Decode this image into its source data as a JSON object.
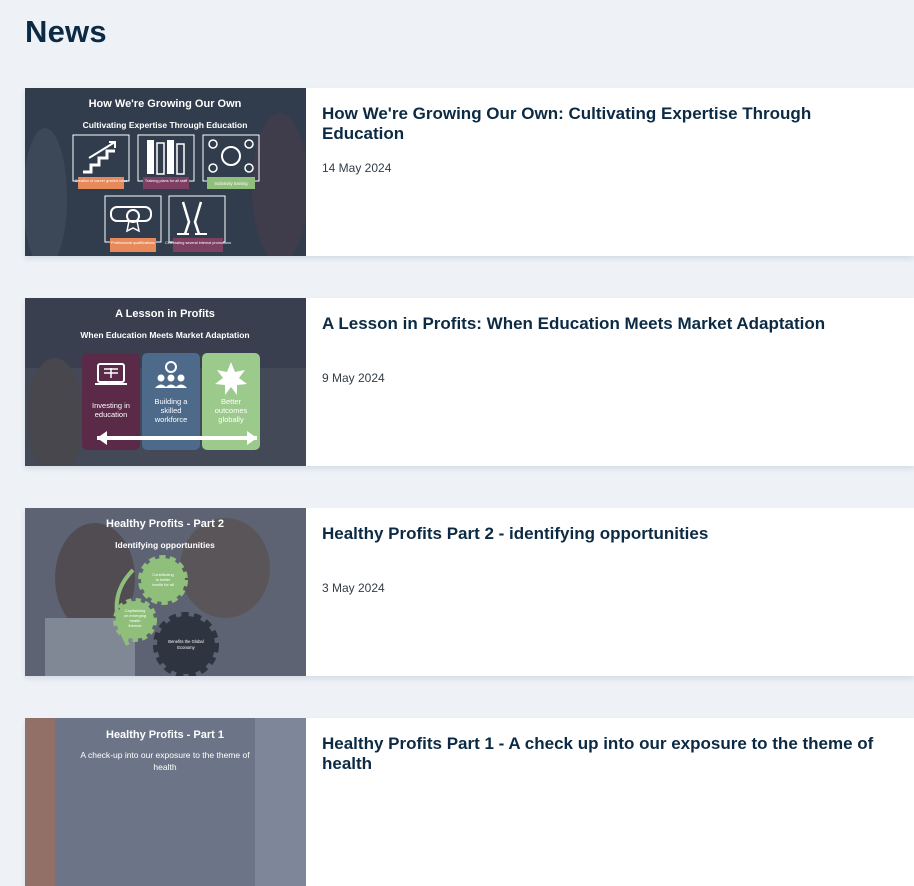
{
  "page": {
    "title": "News"
  },
  "articles": [
    {
      "title": "How We're Growing Our Own: Cultivating Expertise Through Education",
      "date": "14 May 2024",
      "image": {
        "heading": "How We're Growing Our Own",
        "subheading": "Cultivating Expertise Through Education",
        "tiles": [
          {
            "icon": "stairs-arrow-icon",
            "label": "Creation of career graded roles",
            "color": "#e8895a"
          },
          {
            "icon": "books-icon",
            "label": "Training plans for all staff",
            "color": "#7d3f62"
          },
          {
            "icon": "network-icon",
            "label": "Inclusivity training",
            "color": "#8fbf7a"
          },
          {
            "icon": "certificate-icon",
            "label": "Professional qualifications",
            "color": "#e8895a"
          },
          {
            "icon": "champagne-icon",
            "label": "Celebrating several internal promotions",
            "color": "#7d3f62"
          }
        ]
      }
    },
    {
      "title": "A Lesson in Profits: When Education Meets Market Adaptation",
      "date": "9 May 2024",
      "image": {
        "heading": "A Lesson in Profits",
        "subheading": "When Education Meets Market Adaptation",
        "panels": [
          {
            "icon": "laptop-book-icon",
            "lines": [
              "Investing in",
              "education"
            ],
            "color": "#5a2a48"
          },
          {
            "icon": "workforce-icon",
            "lines": [
              "Building a",
              "skilled",
              "workforce"
            ],
            "color": "#4d6a8a"
          },
          {
            "icon": "star-burst-icon",
            "lines": [
              "Better",
              "outcomes",
              "globally"
            ],
            "color": "#9cc98c"
          }
        ]
      }
    },
    {
      "title": "Healthy Profits Part 2 - identifying opportunities",
      "date": "3 May 2024",
      "image": {
        "heading": "Healthy Profits - Part 2",
        "subheading": "Identifying opportunities",
        "gears": [
          {
            "lines": [
              "Contributing",
              "to better",
              "health for all"
            ]
          },
          {
            "lines": [
              "Capitalising",
              "on emerging",
              "health",
              "themes"
            ]
          },
          {
            "lines": [
              "Benefits the Global",
              "Economy"
            ]
          }
        ]
      }
    },
    {
      "title": "Healthy Profits Part 1 - A check up into our exposure to the theme of health",
      "date": "",
      "image": {
        "heading": "Healthy Profits - Part 1",
        "subheading_lines": [
          "A check-up into our exposure to the theme of",
          "health"
        ]
      }
    }
  ]
}
